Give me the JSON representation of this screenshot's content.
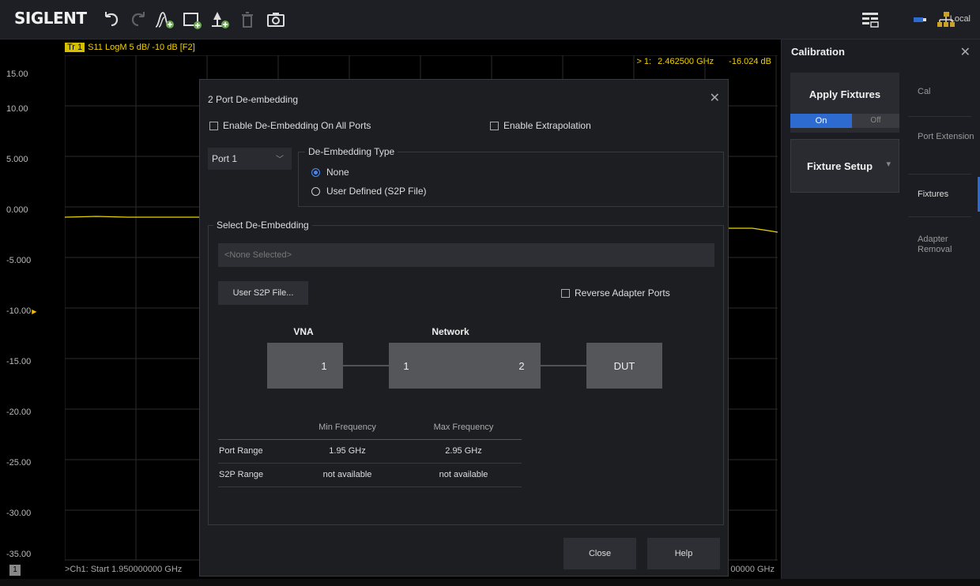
{
  "toolbar": {
    "brand": "SIGLENT",
    "local_label": "Local",
    "icons": [
      "undo-icon",
      "redo-icon",
      "add-trace-icon",
      "add-window-icon",
      "add-marker-icon",
      "delete-icon",
      "camera-icon",
      "grid-layout-icon",
      "usb-icon",
      "network-icon"
    ]
  },
  "plot": {
    "trace_badge": "Tr 1",
    "trace_label": "S11 LogM 5 dB/ -10 dB [F2]",
    "marker": {
      "id": "> 1:",
      "frequency": "2.462500 GHz",
      "value": "-16.024 dB"
    },
    "y_ticks": [
      "15.00",
      "10.00",
      "5.000",
      "0.000",
      "-5.000",
      "-10.00",
      "-15.00",
      "-20.00",
      "-25.00",
      "-30.00",
      "-35.00"
    ],
    "reference_marker": "▶",
    "start_label": ">Ch1: Start 1.950000000 GHz",
    "stop_label": "00000 GHz",
    "channel_badge": "1",
    "trace_color": "#f2d200"
  },
  "calibration": {
    "title": "Calibration",
    "apply_fixtures": "Apply Fixtures",
    "toggle_on": "On",
    "toggle_off": "Off",
    "fixture_setup": "Fixture Setup",
    "tabs": [
      "Cal",
      "Port Extension",
      "Fixtures",
      "Adapter Removal"
    ],
    "active_tab": "Fixtures",
    "accent": "#2e6bd1"
  },
  "dialog": {
    "title": "2 Port De-embedding",
    "enable_all_ports": "Enable De-Embedding On All Ports",
    "enable_extrapolation": "Enable Extrapolation",
    "port_select": "Port 1",
    "type_legend": "De-Embedding Type",
    "type_none": "None",
    "type_user": "User Defined (S2P File)",
    "select_legend": "Select De-Embedding",
    "file_placeholder": "<None Selected>",
    "user_s2p_button": "User S2P File...",
    "reverse_ports": "Reverse Adapter Ports",
    "diagram": {
      "vna_label": "VNA",
      "network_label": "Network",
      "vna_port": "1",
      "network_port_in": "1",
      "network_port_out": "2",
      "dut_label": "DUT"
    },
    "table": {
      "headers": [
        "",
        "Min Frequency",
        "Max Frequency"
      ],
      "rows": [
        [
          "Port Range",
          "1.95 GHz",
          "2.95 GHz"
        ],
        [
          "S2P Range",
          "not available",
          "not available"
        ]
      ]
    },
    "close_button": "Close",
    "help_button": "Help"
  }
}
